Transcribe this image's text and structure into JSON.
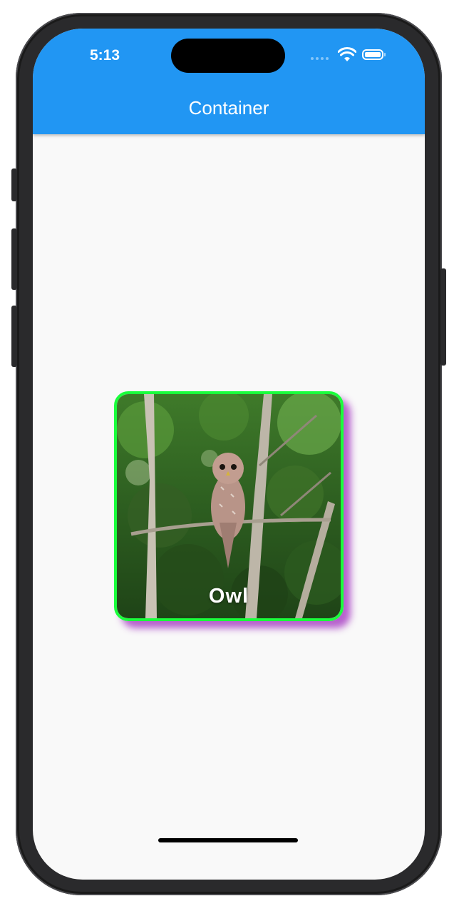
{
  "status_bar": {
    "time": "5:13"
  },
  "app_bar": {
    "title": "Container",
    "color": "#2196f3"
  },
  "card": {
    "label": "Owl",
    "border_color": "#1aff3c",
    "shadow_color": "#af50c8",
    "image": "owl-on-branch-in-forest"
  },
  "icons": [
    "wifi-icon",
    "battery-icon",
    "cellular-signal-icon"
  ]
}
